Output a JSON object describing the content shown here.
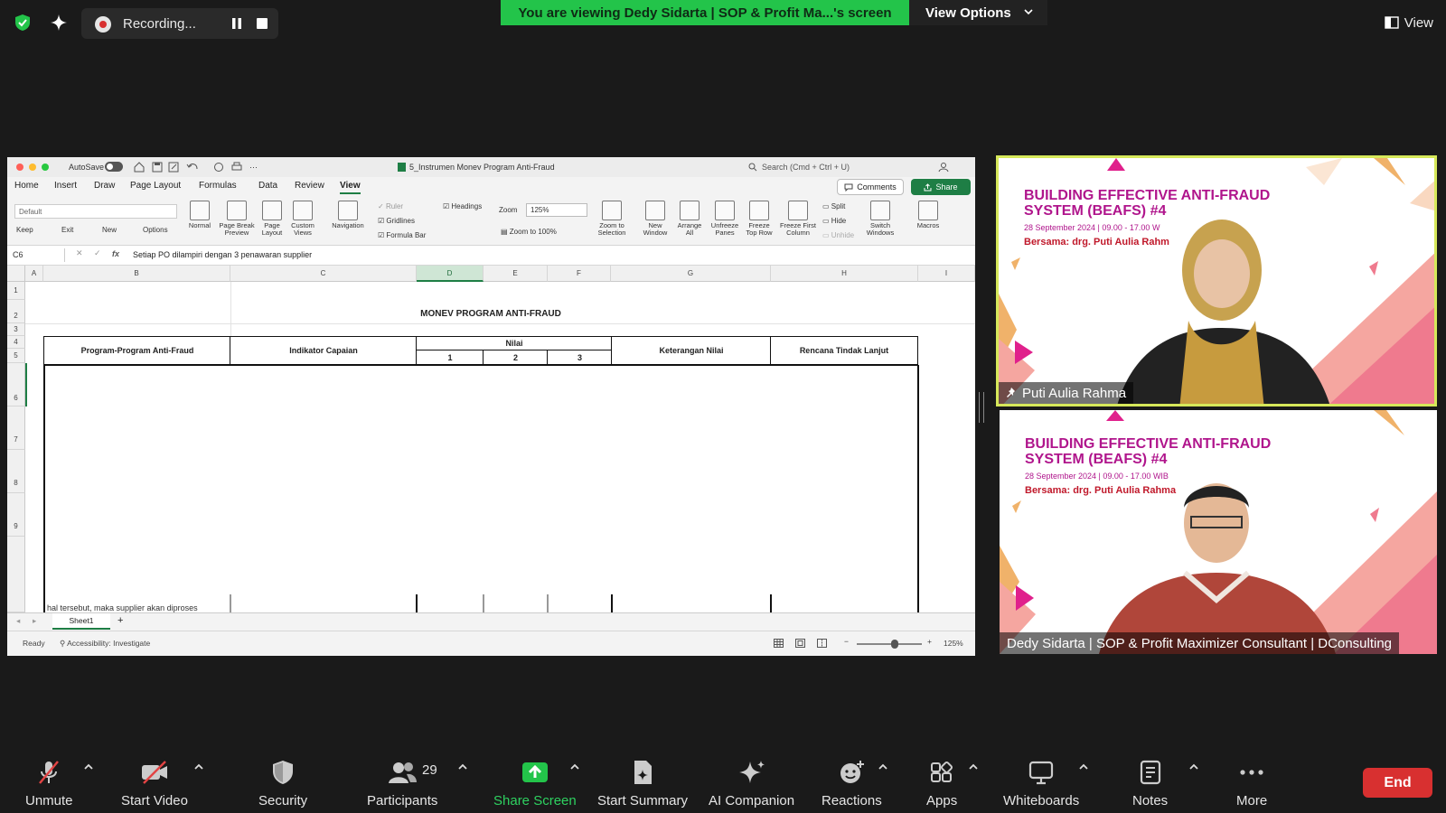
{
  "top_bar": {
    "recording_label": "Recording...",
    "viewing_banner": "You are viewing Dedy Sidarta | SOP & Profit Ma...'s screen",
    "view_options_label": "View Options",
    "view_label": "View"
  },
  "excel": {
    "autosave_label": "AutoSave",
    "filename": "5_Instrumen Monev Program Anti-Fraud",
    "search_placeholder": "Search (Cmd + Ctrl + U)",
    "tabs": [
      "Home",
      "Insert",
      "Draw",
      "Page Layout",
      "Formulas",
      "Data",
      "Review",
      "View"
    ],
    "active_tab": "View",
    "comments_label": "Comments",
    "share_label": "Share",
    "ribbon": {
      "sheet_view_default": "Default",
      "keep": "Keep",
      "exit": "Exit",
      "new": "New",
      "options": "Options",
      "normal": "Normal",
      "page_break_preview": "Page Break Preview",
      "page_layout": "Page Layout",
      "custom_views": "Custom Views",
      "navigation": "Navigation",
      "ruler": "Ruler",
      "gridlines": "Gridlines",
      "formula_bar": "Formula Bar",
      "headings": "Headings",
      "zoom_label": "Zoom",
      "zoom_value": "125%",
      "zoom_100": "Zoom to 100%",
      "zoom_selection": "Zoom to Selection",
      "new_window": "New Window",
      "arrange_all": "Arrange All",
      "unfreeze_panes": "Unfreeze Panes",
      "freeze_top_row": "Freeze Top Row",
      "freeze_first_column": "Freeze First Column",
      "split": "Split",
      "hide": "Hide",
      "unhide": "Unhide",
      "switch_windows": "Switch Windows",
      "macros": "Macros"
    },
    "name_box": "C6",
    "fx": "fx",
    "formula": "Setiap PO dilampiri dengan 3 penawaran supplier",
    "columns": [
      "A",
      "B",
      "C",
      "D",
      "E",
      "F",
      "G",
      "H",
      "I"
    ],
    "rows": [
      "1",
      "2",
      "3",
      "4",
      "5",
      "6",
      "7",
      "8",
      "9"
    ],
    "sheet_title": "MONEV PROGRAM ANTI-FRAUD",
    "headers": {
      "program": "Program-Program Anti-Fraud",
      "indikator": "Indikator Capaian",
      "nilai": "Nilai",
      "n1": "1",
      "n2": "2",
      "n3": "3",
      "keterangan": "Keterangan Nilai",
      "rencana": "Rencana Tindak Lanjut"
    },
    "partial_text": "hal tersebut, maka supplier akan diproses",
    "sheet_tab": "Sheet1",
    "add_sheet": "+",
    "status_ready": "Ready",
    "status_accessibility": "Accessibility: Investigate",
    "status_zoom": "125%"
  },
  "tiles": [
    {
      "slide_title": "BUILDING EFFECTIVE ANTI-FRAUD SYSTEM (BEAFS) #4",
      "slide_date": "28 September 2024 | 09.00 - 17.00 W",
      "slide_with": "Bersama: drg. Puti Aulia Rahm",
      "name": "Puti Aulia Rahma"
    },
    {
      "slide_title": "BUILDING EFFECTIVE ANTI-FRAUD SYSTEM (BEAFS) #4",
      "slide_date": "28 September 2024 | 09.00 - 17.00 WIB",
      "slide_with": "Bersama: drg. Puti Aulia Rahma",
      "name": "Dedy Sidarta | SOP & Profit Maximizer Consultant | DConsulting"
    }
  ],
  "toolbar": {
    "unmute": "Unmute",
    "start_video": "Start Video",
    "security": "Security",
    "participants": "Participants",
    "participants_count": "29",
    "share_screen": "Share Screen",
    "start_summary": "Start Summary",
    "ai_companion": "AI Companion",
    "reactions": "Reactions",
    "apps": "Apps",
    "whiteboards": "Whiteboards",
    "notes": "Notes",
    "more": "More",
    "end": "End"
  },
  "colors": {
    "banner_green": "#23c44a",
    "excel_green": "#1e7e45",
    "slide_magenta": "#b0158c",
    "end_red": "#d83030",
    "active_speaker": "#d6e85a"
  }
}
